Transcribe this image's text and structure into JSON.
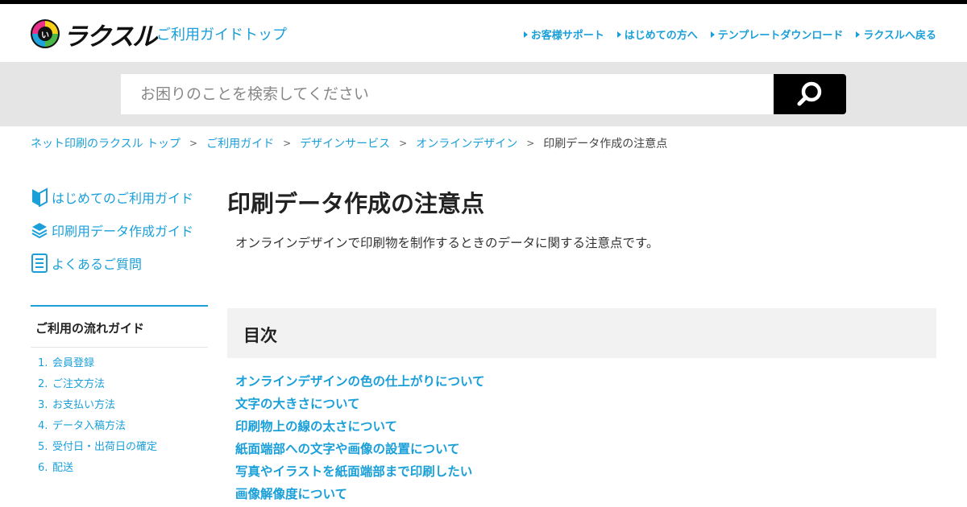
{
  "header": {
    "logo_mark_text": "い",
    "logo_text": "ラクスル",
    "guide_top": "ご利用ガイドトップ",
    "links": [
      {
        "label": "お客様サポート"
      },
      {
        "label": "はじめての方へ"
      },
      {
        "label": "テンプレートダウンロード"
      },
      {
        "label": "ラクスルへ戻る"
      }
    ]
  },
  "search": {
    "placeholder": "お困りのことを検索してください",
    "button_icon": "search-icon"
  },
  "breadcrumb": {
    "items": [
      {
        "label": "ネット印刷のラクスル トップ"
      },
      {
        "label": "ご利用ガイド"
      },
      {
        "label": "デザインサービス"
      },
      {
        "label": "オンラインデザイン"
      }
    ],
    "separator": ">",
    "current": "印刷データ作成の注意点"
  },
  "sidebar": {
    "links": [
      {
        "label": "はじめてのご利用ガイド",
        "icon": "beginner-mark-icon"
      },
      {
        "label": "印刷用データ作成ガイド",
        "icon": "paper-stack-icon"
      },
      {
        "label": "よくあるご質問",
        "icon": "document-list-icon"
      }
    ],
    "flow": {
      "title": "ご利用の流れガイド",
      "items": [
        {
          "num": "1.",
          "label": "会員登録"
        },
        {
          "num": "2.",
          "label": "ご注文方法"
        },
        {
          "num": "3.",
          "label": "お支払い方法"
        },
        {
          "num": "4.",
          "label": "データ入稿方法"
        },
        {
          "num": "5.",
          "label": "受付日・出荷日の確定"
        },
        {
          "num": "6.",
          "label": "配送"
        }
      ]
    }
  },
  "main": {
    "title": "印刷データ作成の注意点",
    "lead": "オンラインデザインで印刷物を制作するときのデータに関する注意点です。",
    "toc": {
      "heading": "目次",
      "items": [
        "オンラインデザインの色の仕上がりについて",
        "文字の大きさについて",
        "印刷物上の線の太さについて",
        "紙面端部への文字や画像の設置について",
        "写真やイラストを紙面端部まで印刷したい",
        "画像解像度について"
      ]
    }
  },
  "colors": {
    "accent": "#1a9fd9",
    "topbar": "#000000",
    "search_band": "#e5e5e5",
    "toc_bg": "#f2f2f2"
  }
}
